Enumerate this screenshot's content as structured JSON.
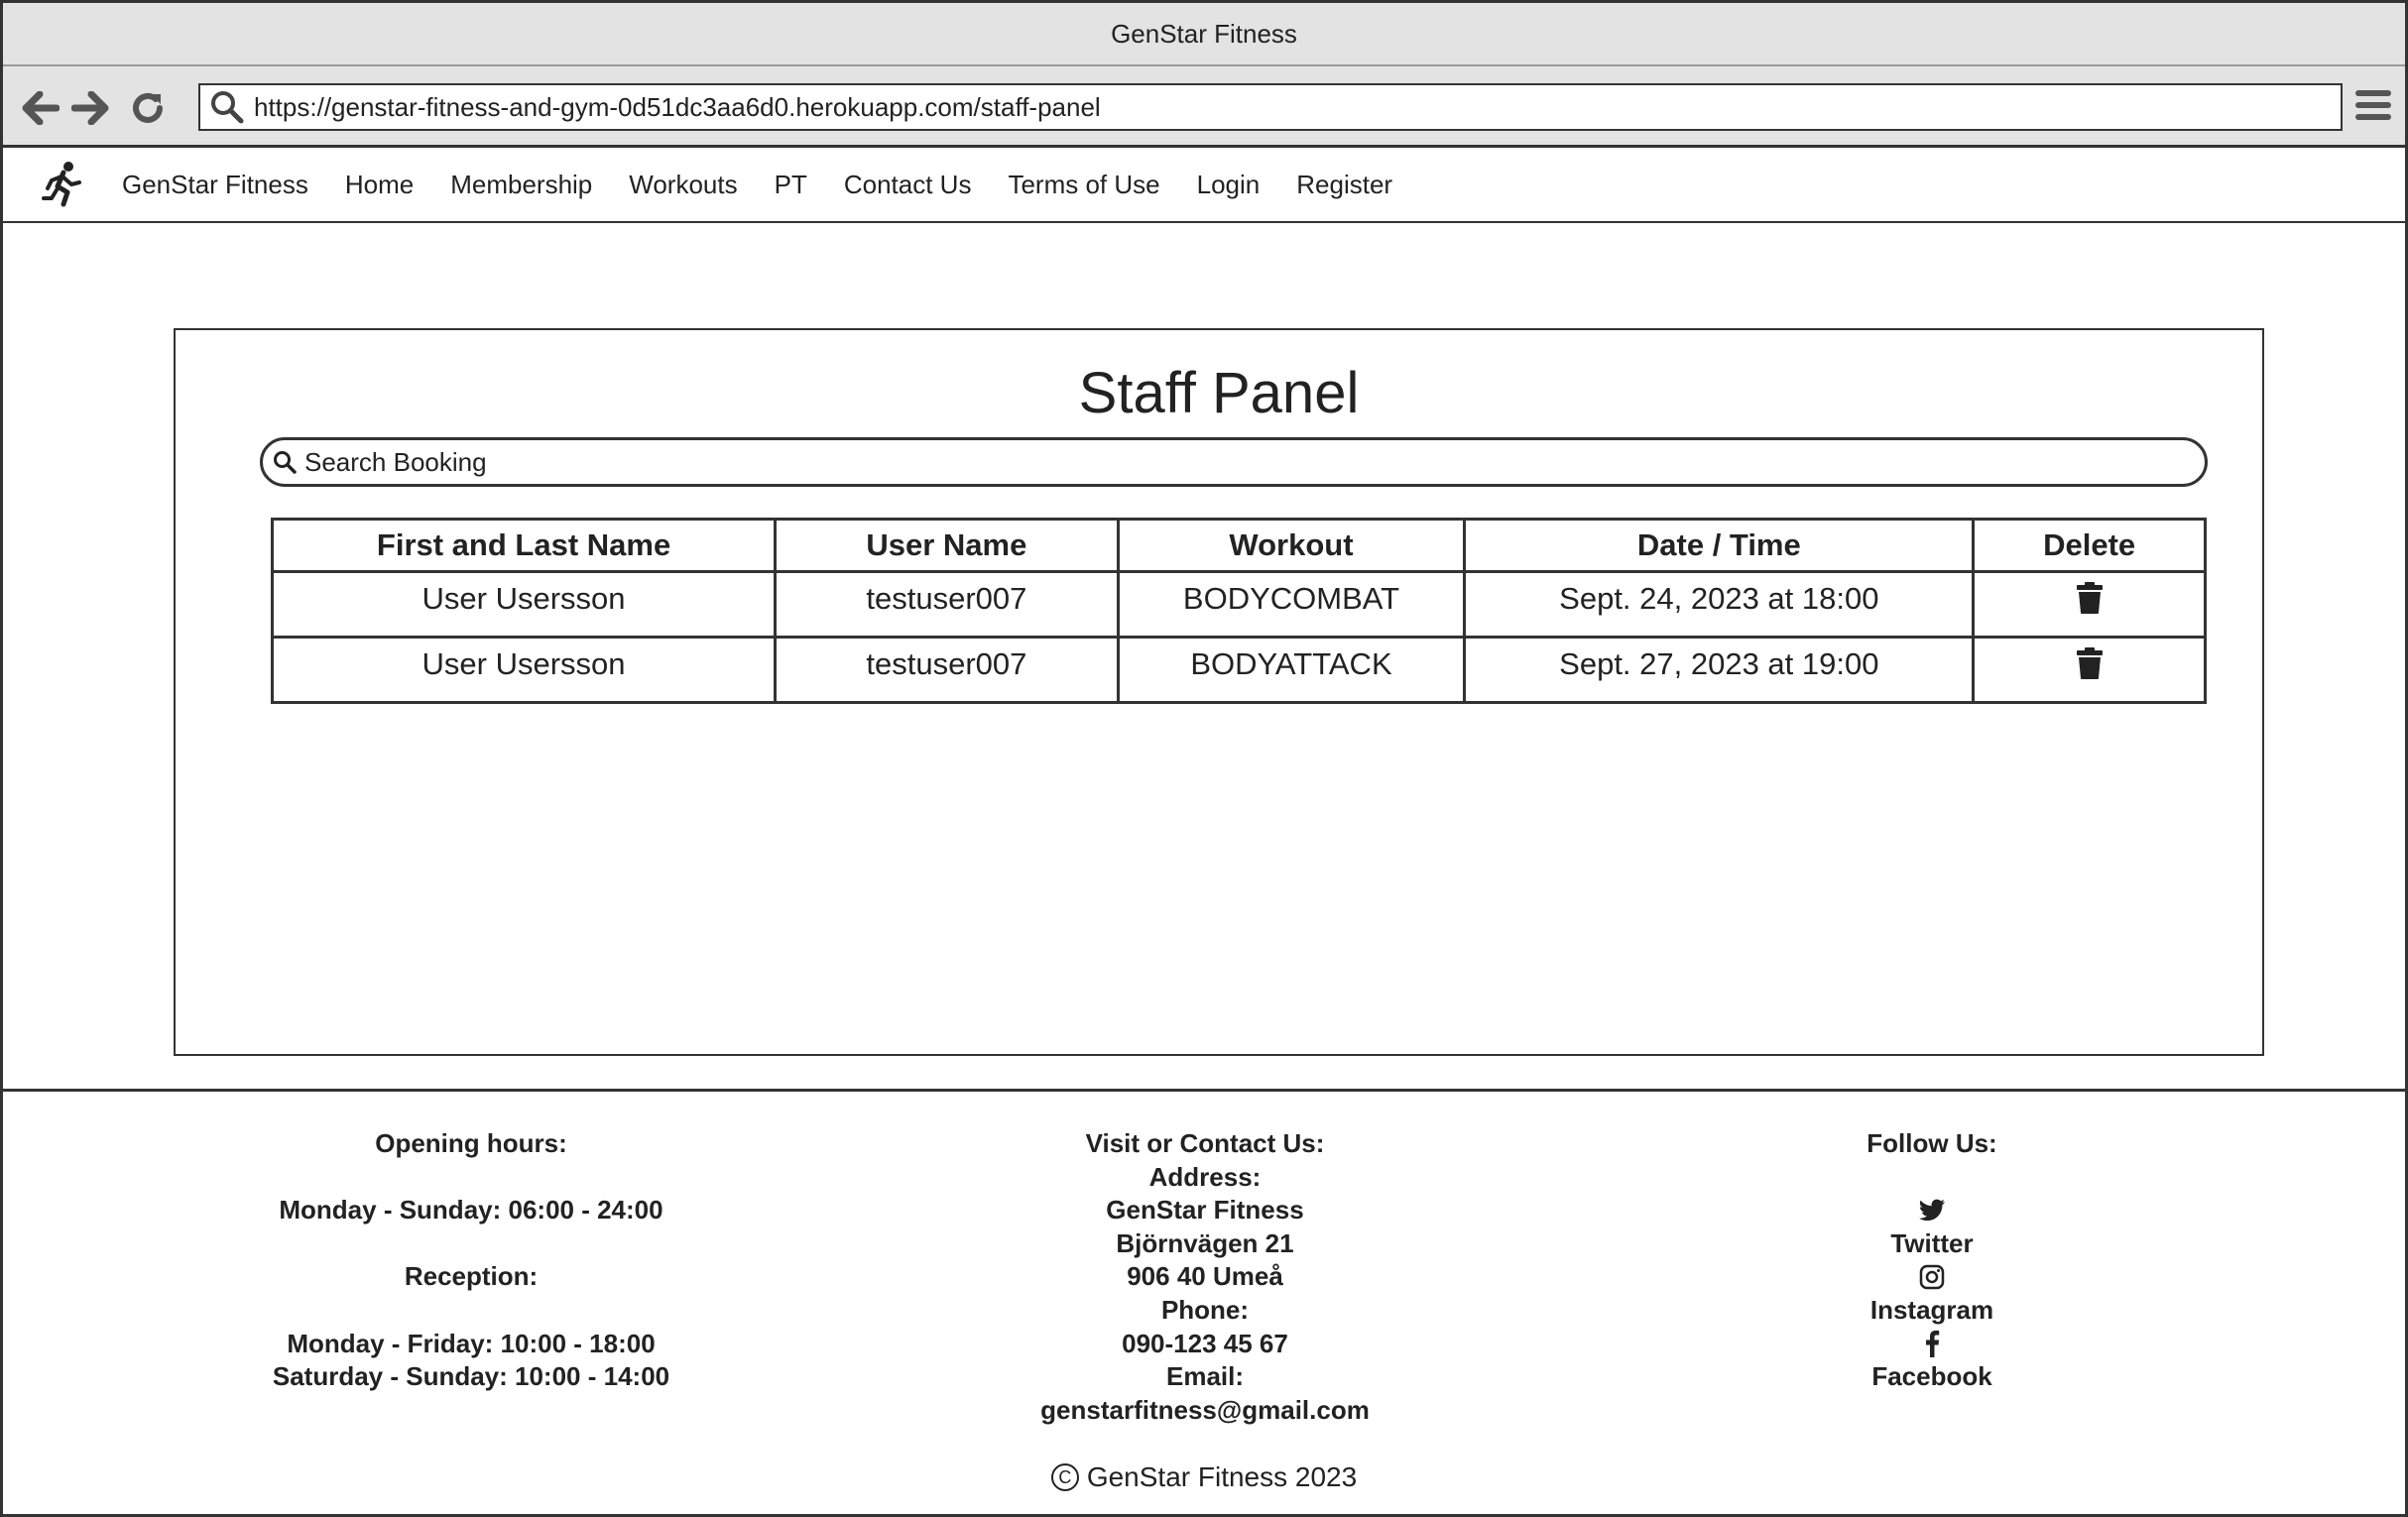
{
  "window": {
    "title": "GenStar Fitness"
  },
  "browser": {
    "url": "https://genstar-fitness-and-gym-0d51dc3aa6d0.herokuapp.com/staff-panel",
    "icons": [
      "back-arrow-icon",
      "forward-arrow-icon",
      "reload-icon",
      "search-icon",
      "hamburger-menu-icon"
    ]
  },
  "navbar": {
    "brand": "GenStar Fitness",
    "links": [
      "Home",
      "Membership",
      "Workouts",
      "PT",
      "Contact Us",
      "Terms of Use",
      "Login",
      "Register"
    ]
  },
  "panel": {
    "title": "Staff Panel",
    "search_placeholder": "Search Booking",
    "columns": [
      "First and Last Name",
      "User Name",
      "Workout",
      "Date / Time",
      "Delete"
    ],
    "rows": [
      {
        "name": "User Usersson",
        "username": "testuser007",
        "workout": "BODYCOMBAT",
        "datetime": "Sept. 24, 2023 at 18:00"
      },
      {
        "name": "User Usersson",
        "username": "testuser007",
        "workout": "BODYATTACK",
        "datetime": "Sept. 27, 2023 at 19:00"
      }
    ]
  },
  "footer": {
    "hours": {
      "heading": "Opening hours:",
      "gym": "Monday - Sunday: 06:00 - 24:00",
      "reception_heading": "Reception:",
      "weekday": "Monday - Friday: 10:00 - 18:00",
      "weekend": "Saturday - Sunday: 10:00 - 14:00"
    },
    "contact": {
      "heading": "Visit or Contact Us:",
      "address_label": "Address:",
      "name": "GenStar Fitness",
      "street": "Björnvägen 21",
      "city": "906 40 Umeå",
      "phone_label": "Phone:",
      "phone": "090-123 45 67",
      "email_label": "Email:",
      "email": "genstarfitness@gmail.com"
    },
    "social": {
      "heading": "Follow Us:",
      "twitter": "Twitter",
      "instagram": "Instagram",
      "facebook": "Facebook"
    },
    "copyright": "GenStar Fitness 2023"
  }
}
